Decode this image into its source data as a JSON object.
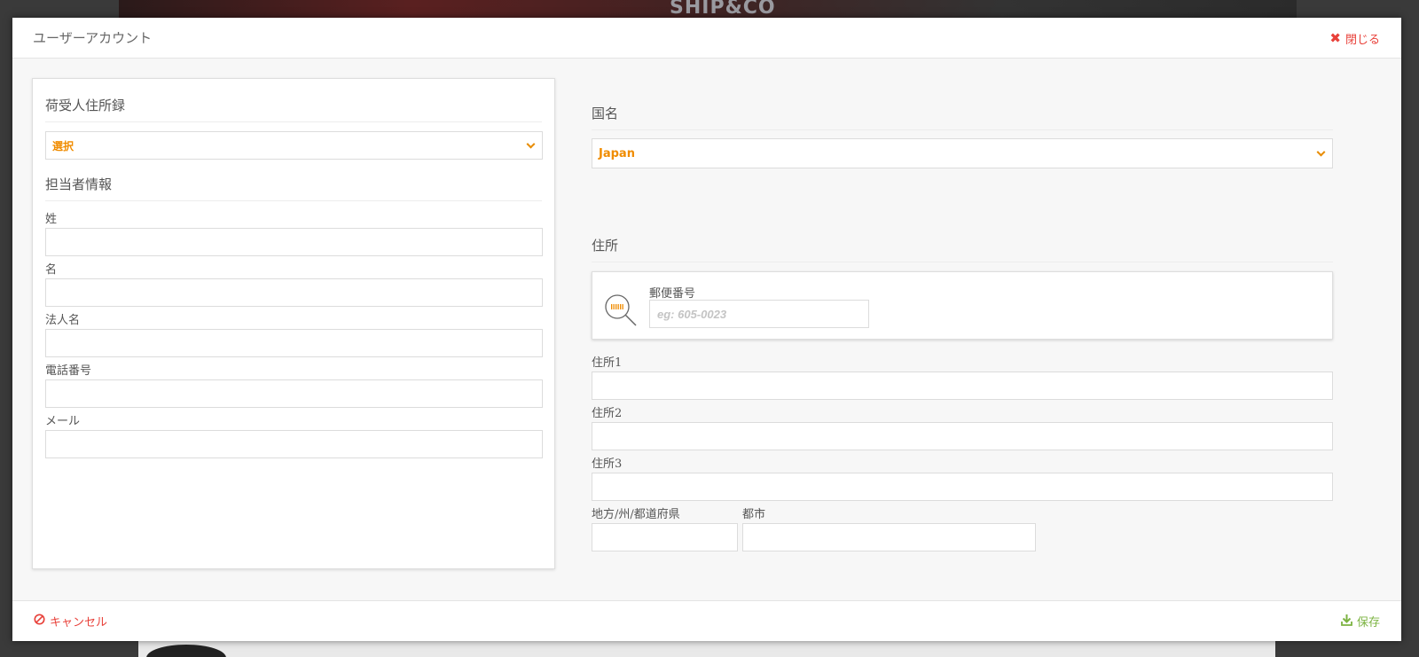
{
  "background": {
    "brand_text": "SHIP&CO"
  },
  "modal": {
    "title": "ユーザーアカウント",
    "close_label": "閉じる",
    "cancel_label": "キャンセル",
    "save_label": "保存"
  },
  "left": {
    "address_book_heading": "荷受人住所録",
    "address_book_select": "選択",
    "contact_heading": "担当者情報",
    "fields": {
      "last_name_label": "姓",
      "first_name_label": "名",
      "company_label": "法人名",
      "phone_label": "電話番号",
      "email_label": "メール"
    }
  },
  "right": {
    "country_heading": "国名",
    "country_value": "Japan",
    "address_heading": "住所",
    "zip_label": "郵便番号",
    "zip_placeholder": "eg: 605-0023",
    "address1_label": "住所1",
    "address2_label": "住所2",
    "address3_label": "住所3",
    "prefecture_label": "地方/州/都道府県",
    "city_label": "都市"
  },
  "colors": {
    "accent_orange": "#f08c00",
    "danger_red": "#e8413a",
    "success_green": "#7cb342"
  }
}
